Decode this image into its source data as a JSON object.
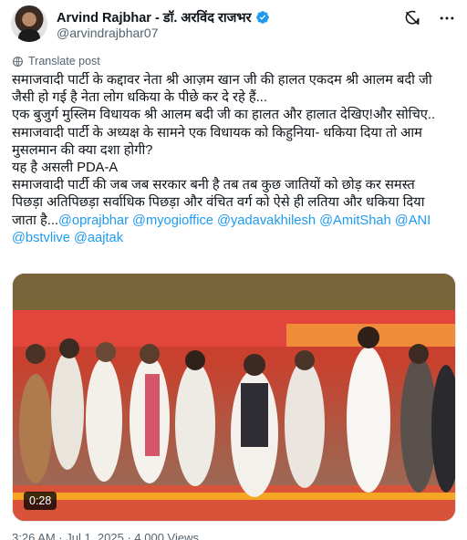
{
  "author": {
    "name": "Arvind Rajbhar - डॉ. अरविंद राजभर",
    "handle": "@arvindrajbhar07",
    "verified": true,
    "verified_color": "#1d9bf0"
  },
  "header_icons": [
    "grok-icon",
    "more-options-icon"
  ],
  "translate_label": "Translate post",
  "post": {
    "lines": [
      "समाजवादी पार्टी के कद्दावर नेता श्री आज़म खान जी की हालत एकदम श्री आलम बदी जी",
      "जैसी हो गई है नेता लोग धकिया के पीछे कर दे रहे हैं...",
      "एक बुजुर्ग मुस्लिम विधायक श्री आलम बदी जी का हालत और हालात देखिए!और सोचिए..",
      "समाजवादी पार्टी के अध्यक्ष के सामने एक विधायक को किहुनिया- धकिया दिया तो आम",
      "मुसलमान की क्या दशा होगी?",
      "यह है असली PDA-A",
      "समाजवादी पार्टी की जब जब सरकार बनी है तब तब कुछ जातियों को छोड़ कर समस्त",
      "पिछड़ा अतिपिछड़ा सर्वाधिक पिछड़ा और वंचित वर्ग को ऐसे ही लतिया और धकिया दिया"
    ],
    "last_line_prefix": "जाता है...",
    "mentions_line1": "@oprajbhar @myogioffice @yadavakhilesh @AmitShah @ANI",
    "mentions_line2": "@bstvlive @aajtak",
    "mention_color": "#1d9bf0"
  },
  "video": {
    "duration": "0:28"
  },
  "timestamp": "3:26 AM · Jul 1, 2025 · 4,000 Views"
}
